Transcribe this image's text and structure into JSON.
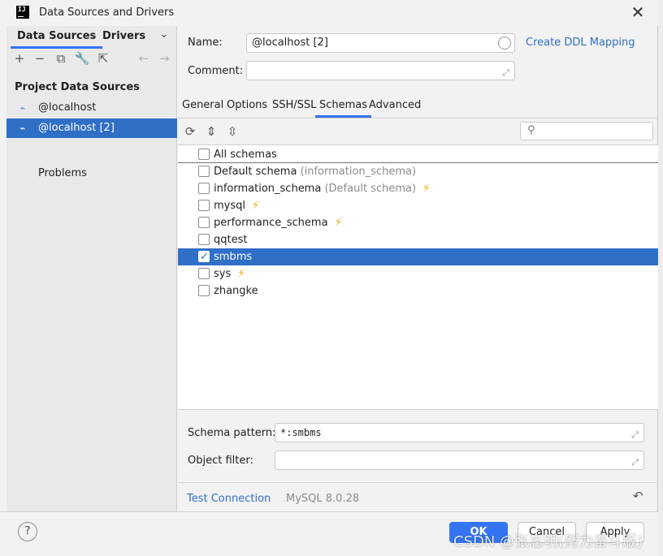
{
  "window": {
    "title": "Data Sources and Drivers"
  },
  "left": {
    "tabs": [
      "Data Sources",
      "Drivers"
    ],
    "section_title": "Project Data Sources",
    "items": [
      "@localhost",
      "@localhost [2]"
    ],
    "selected_index": 1,
    "problems_label": "Problems"
  },
  "form": {
    "name_label": "Name:",
    "name_value": "@localhost [2]",
    "comment_label": "Comment:",
    "comment_value": "",
    "ddl_link": "Create DDL Mapping"
  },
  "tabs": [
    "General",
    "Options",
    "SSH/SSL",
    "Schemas",
    "Advanced"
  ],
  "active_tab": "Schemas",
  "schemas": {
    "search_placeholder": "",
    "all_label": "All schemas",
    "rows": [
      {
        "name": "Default schema",
        "note": "(information_schema)",
        "bolt": false,
        "checked": false
      },
      {
        "name": "information_schema",
        "note": "(Default schema)",
        "bolt": true,
        "checked": false
      },
      {
        "name": "mysql",
        "note": "",
        "bolt": true,
        "checked": false
      },
      {
        "name": "performance_schema",
        "note": "",
        "bolt": true,
        "checked": false
      },
      {
        "name": "qqtest",
        "note": "",
        "bolt": false,
        "checked": false
      },
      {
        "name": "smbms",
        "note": "",
        "bolt": false,
        "checked": true
      },
      {
        "name": "sys",
        "note": "",
        "bolt": true,
        "checked": false
      },
      {
        "name": "zhangke",
        "note": "",
        "bolt": false,
        "checked": false
      }
    ]
  },
  "bottom": {
    "schema_pattern_label": "Schema pattern:",
    "schema_pattern_value": "*:smbms",
    "object_filter_label": "Object filter:",
    "object_filter_value": "",
    "test_connection": "Test Connection",
    "driver_version": "MySQL 8.0.28"
  },
  "footer": {
    "help": "?",
    "ok": "OK",
    "cancel": "Cancel",
    "apply": "Apply"
  },
  "watermark": "CSDN @张志明(努力奋斗版)",
  "colors": {
    "accent": "#3574f0",
    "selection": "#2f6fc6",
    "bolt": "#f0a30a"
  }
}
